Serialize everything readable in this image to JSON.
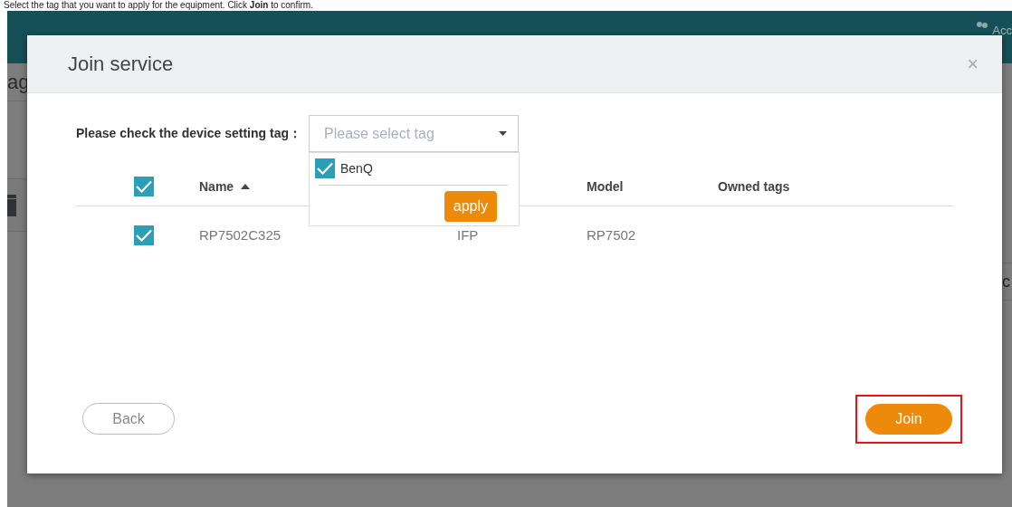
{
  "document_text": "Select the tag that you want to apply for the equipment. Click **Join** to confirm.",
  "background_app": {
    "header_text": "Acc",
    "left_text": "ag",
    "right_text": "c"
  },
  "dialog": {
    "title": "Join service",
    "close_glyph": "×",
    "filter": {
      "label": "Please check the device setting tag：",
      "placeholder": "Please select tag",
      "expanded": true,
      "options": [
        {
          "label": "BenQ",
          "checked": true
        }
      ],
      "apply_label": "apply"
    },
    "table": {
      "select_all_checked": true,
      "columns": [
        {
          "label": "Name",
          "sorted": true
        },
        {
          "label": "Model",
          "sorted": false
        },
        {
          "label": "Owned tags",
          "sorted": false
        }
      ],
      "rows": [
        {
          "checked": true,
          "name": "RP7502C325",
          "column_3": "IFP",
          "model": "RP7502"
        }
      ]
    },
    "buttons": [
      {
        "kind": "secondary",
        "label": "Back",
        "highlighted": false
      },
      {
        "kind": "primary",
        "label": "Join",
        "highlighted": true
      }
    ]
  }
}
